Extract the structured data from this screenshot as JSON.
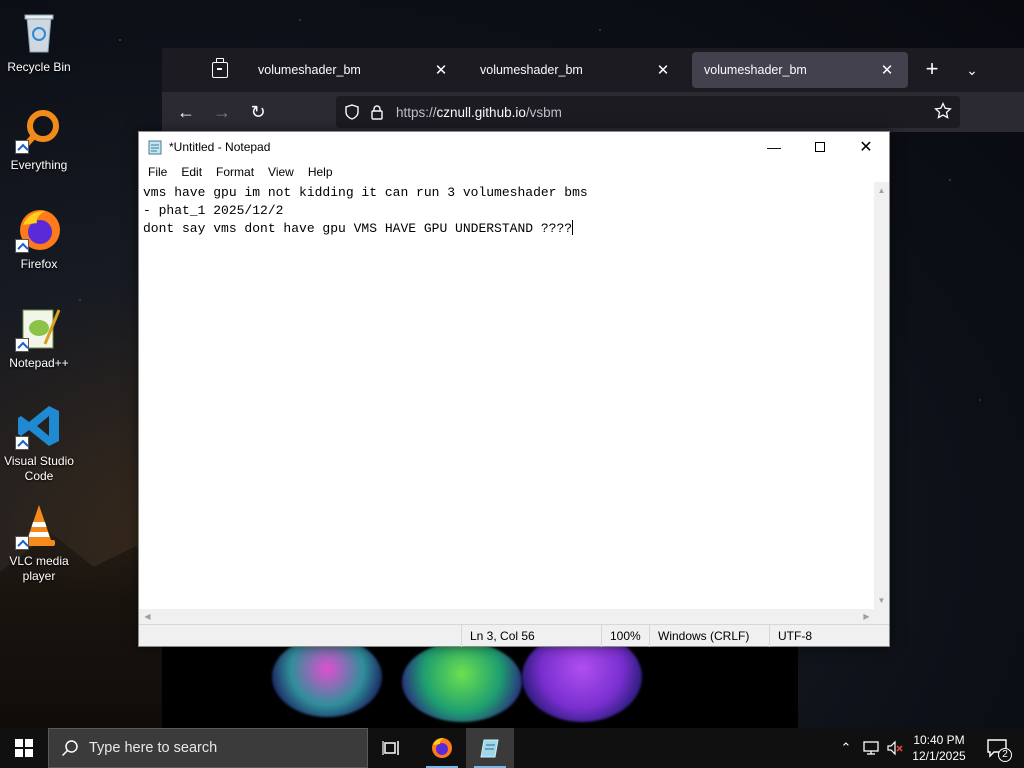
{
  "desktop": {
    "icons": [
      {
        "label": "Recycle Bin"
      },
      {
        "label": "Everything"
      },
      {
        "label": "Firefox"
      },
      {
        "label": "Notepad++"
      },
      {
        "label": "Visual Studio Code"
      },
      {
        "label": "VLC media player"
      }
    ]
  },
  "browser": {
    "tabs": [
      {
        "label": "volumeshader_bm"
      },
      {
        "label": "volumeshader_bm"
      },
      {
        "label": "volumeshader_bm"
      }
    ],
    "active_tab": 2,
    "url_prefix": "https://",
    "url_domain": "cznull.github.io",
    "url_path": "/vsbm"
  },
  "notepad": {
    "title": "*Untitled - Notepad",
    "menu": [
      "File",
      "Edit",
      "Format",
      "View",
      "Help"
    ],
    "lines": [
      "vms have gpu im not kidding it can run 3 volumeshader bms",
      "- phat_1 2025/12/2",
      "dont say vms dont have gpu VMS HAVE GPU UNDERSTAND ????"
    ],
    "status": {
      "position": "Ln 3, Col 56",
      "zoom": "100%",
      "line_ending": "Windows (CRLF)",
      "encoding": "UTF-8"
    }
  },
  "taskbar": {
    "search_placeholder": "Type here to search",
    "time": "10:40 PM",
    "date": "12/1/2025",
    "notification_count": "2"
  },
  "colors": {
    "taskbar_bg": "#101010",
    "firefox_bg": "#1c1b22",
    "accent": "#76b9ed"
  }
}
